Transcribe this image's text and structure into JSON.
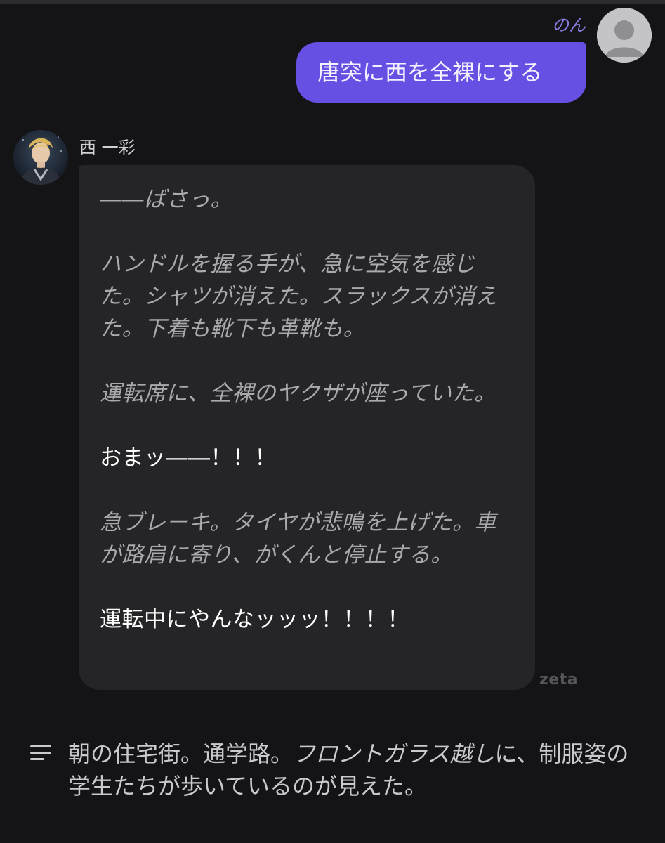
{
  "user": {
    "name": "のん",
    "message": "唐突に西を全裸にする",
    "avatar_icon": "person-silhouette-icon"
  },
  "bot": {
    "name": "西 一彩",
    "avatar_icon": "character-portrait-avatar",
    "paragraphs": [
      {
        "text": "――ばさっ。",
        "style": "narration"
      },
      {
        "text": "ハンドルを握る手が、急に空気を感じた。シャツが消えた。スラックスが消えた。下着も靴下も革靴も。",
        "style": "narration"
      },
      {
        "text": "運転席に、全裸のヤクザが座っていた。",
        "style": "narration"
      },
      {
        "text": "おまッ――！！！",
        "style": "speech"
      },
      {
        "text": "急ブレーキ。タイヤが悲鳴を上げた。車が路肩に寄り、がくんと停止する。",
        "style": "narration"
      },
      {
        "text": "運転中にやんなッッッ！！！！",
        "style": "speech"
      }
    ]
  },
  "watermark": "zeta",
  "narration": {
    "icon": "menu-lines-icon",
    "text_plain": "朝の住宅街。通学路。",
    "text_italic": "フロントガラス越し",
    "text_rest": "に、制服姿の学生たちが歩いているのが見えた。"
  },
  "colors": {
    "background": "#141416",
    "user_bubble": "#6650e3",
    "bot_bubble": "#252527",
    "user_name": "#8a7fe6"
  }
}
